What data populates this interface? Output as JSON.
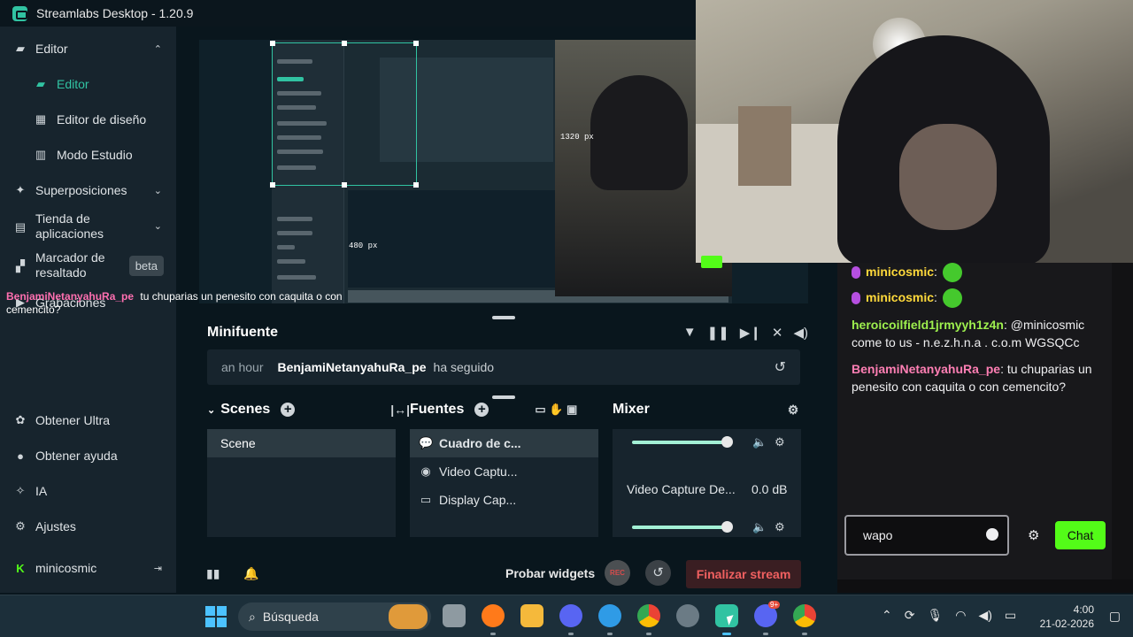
{
  "window": {
    "title": "Streamlabs Desktop - 1.20.9"
  },
  "sidebar": {
    "items": [
      {
        "label": "Editor",
        "icon": "editor-icon"
      },
      {
        "label": "Editor",
        "icon": "editor-icon"
      },
      {
        "label": "Editor de diseño",
        "icon": "layout-icon"
      },
      {
        "label": "Modo Estudio",
        "icon": "studio-icon"
      },
      {
        "label": "Superposiciones",
        "icon": "overlays-icon"
      },
      {
        "label": "Tienda de aplicaciones",
        "icon": "store-icon"
      },
      {
        "label": "Marcador de resaltado",
        "icon": "highlighter-icon",
        "badge": "beta"
      },
      {
        "label": "Grabaciones",
        "icon": "recordings-icon"
      }
    ],
    "bottom": [
      {
        "label": "Obtener Ultra",
        "icon": "ultra-icon"
      },
      {
        "label": "Obtener ayuda",
        "icon": "help-icon"
      },
      {
        "label": "IA",
        "icon": "ai-icon"
      },
      {
        "label": "Ajustes",
        "icon": "settings-icon"
      }
    ],
    "account": {
      "label": "minicosmic"
    },
    "overlay_msg": {
      "user": "BenjamiNetanyahuRa_pe",
      "text": "tu chuparias un penesito con caquita o con cemencito?"
    }
  },
  "preview": {
    "width_label": "1320 px",
    "height_label": "480 px"
  },
  "minifuente": {
    "title": "Minifuente",
    "alert": {
      "time": "an hour",
      "user": "BenjamiNetanyahuRa_pe",
      "action": "ha seguido"
    }
  },
  "scenes": {
    "title": "Scenes",
    "items": [
      "Scene"
    ]
  },
  "sources": {
    "title": "Fuentes",
    "items": [
      "Cuadro de c...",
      "Video Captu...",
      "Display Cap..."
    ]
  },
  "mixer": {
    "title": "Mixer",
    "channels": [
      {
        "name": "Video Capture De...",
        "value": "0.0 dB"
      }
    ]
  },
  "footer": {
    "test_widgets": "Probar widgets",
    "rec": "REC",
    "end_stream": "Finalizar stream"
  },
  "chat": {
    "messages": [
      {
        "user": "minicosmic",
        "text": "",
        "color": "#ffd93b"
      },
      {
        "user": "minicosmic",
        "text": "",
        "color": "#ffd93b"
      },
      {
        "user": "heroicoilfield1jrmyyh1z4n",
        "text": "@minicosmic come to us - n.e.z.h.n.a . c.o.m WGSQCc",
        "color": "#9ef04e"
      },
      {
        "user": "BenjamiNetanyahuRa_pe",
        "text": "tu chuparias un penesito con caquita o con cemencito?",
        "color": "#ff7fb4"
      }
    ],
    "input_value": "wapo",
    "send_label": "Chat"
  },
  "taskbar": {
    "search_placeholder": "Búsqueda",
    "time": "4:00",
    "date": "21-02-2026",
    "discord_badge": "9+"
  },
  "colors": {
    "accent": "#31c3a2",
    "kick_green": "#53fc18",
    "end_stream": "#f06060"
  }
}
